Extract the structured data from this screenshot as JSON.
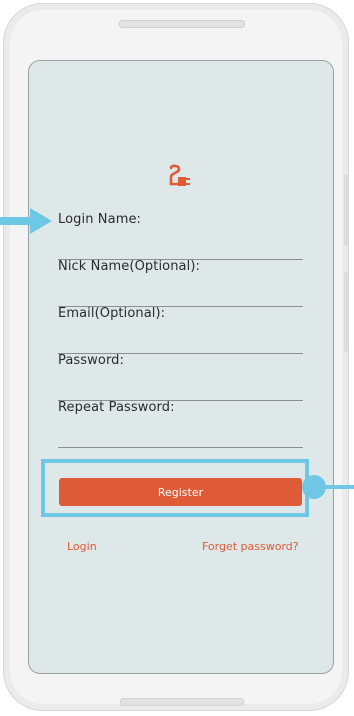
{
  "app": {
    "logo_icon": "plug-icon",
    "accent_color": "#df5b37",
    "screen_background": "#dfe8e9"
  },
  "form": {
    "fields": [
      {
        "label": "Login Name:"
      },
      {
        "label": "Nick Name(Optional):"
      },
      {
        "label": "Email(Optional):"
      },
      {
        "label": "Password:"
      },
      {
        "label": "Repeat Password:"
      }
    ],
    "register_label": "Register"
  },
  "links": {
    "login": "Login",
    "forgot": "Forget password?"
  },
  "annotations": {
    "color": "#6ec7e4",
    "arrow_icon": "arrow-right-icon",
    "dot_icon": "callout-dot"
  }
}
